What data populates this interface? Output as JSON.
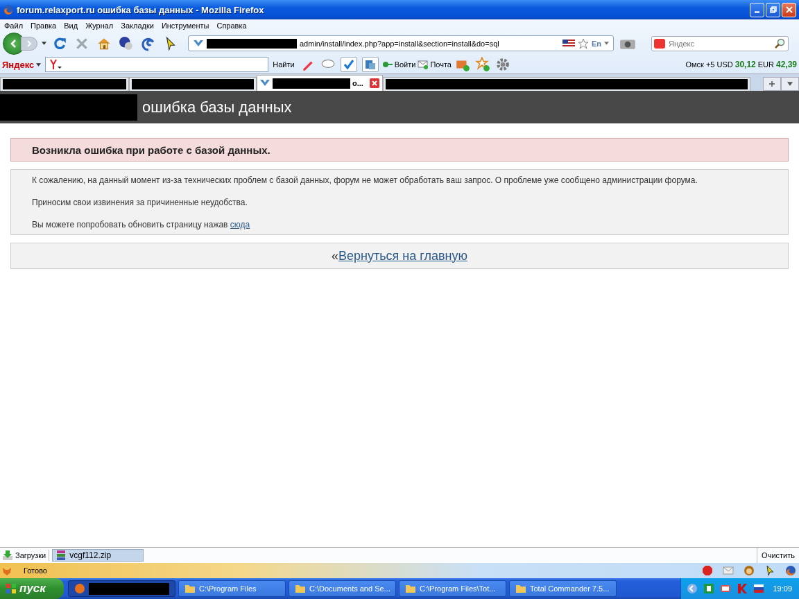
{
  "window": {
    "title": "forum.relaxport.ru ошибка базы данных - Mozilla Firefox"
  },
  "menu": [
    "Файл",
    "Правка",
    "Вид",
    "Журнал",
    "Закладки",
    "Инструменты",
    "Справка"
  ],
  "address_bar": {
    "url": "admin/install/index.php?app=install&section=install&do=sql",
    "lang": "En"
  },
  "search": {
    "placeholder": "Яндекс"
  },
  "yandex_bar": {
    "logo": "Яндекс",
    "find_button": "Найти",
    "login": "Войти",
    "mail": "Почта",
    "city": "Омск",
    "weather": "+5",
    "usd_label": "USD",
    "usd": "30,12",
    "eur_label": "EUR",
    "eur": "42,39"
  },
  "tabs": [
    {
      "selected": false
    },
    {
      "selected": false
    },
    {
      "title": "о...",
      "selected": true
    },
    {
      "selected": false
    }
  ],
  "page": {
    "header": "ошибка базы данных",
    "error": "Возникла ошибка при работе с базой данных.",
    "paragraphs": [
      "К сожалению, на данный момент из-за технических проблем с базой данных, форум не может обработать ваш запрос. О проблеме уже сообщено администрации форума.",
      "Приносим свои извинения за причиненные неудобства.",
      "Вы можете попробовать обновить страницу нажав"
    ],
    "refresh_link": "сюда",
    "back_mark": "«",
    "back_link": "Вернуться на главную"
  },
  "downloads": {
    "label": "Загрузки",
    "file": "vcgf112.zip",
    "clear": "Очистить"
  },
  "status": "Готово",
  "taskbar": {
    "start": "пуск",
    "clock": "19:09",
    "tasks": [
      {
        "selected": true
      },
      {
        "title": "C:\\Program Files",
        "selected": false
      },
      {
        "title": "C:\\Documents and Se...",
        "selected": false
      },
      {
        "title": "C:\\Program Files\\Tot...",
        "selected": false
      },
      {
        "title": "Total Commander 7.5...",
        "selected": false
      }
    ]
  }
}
